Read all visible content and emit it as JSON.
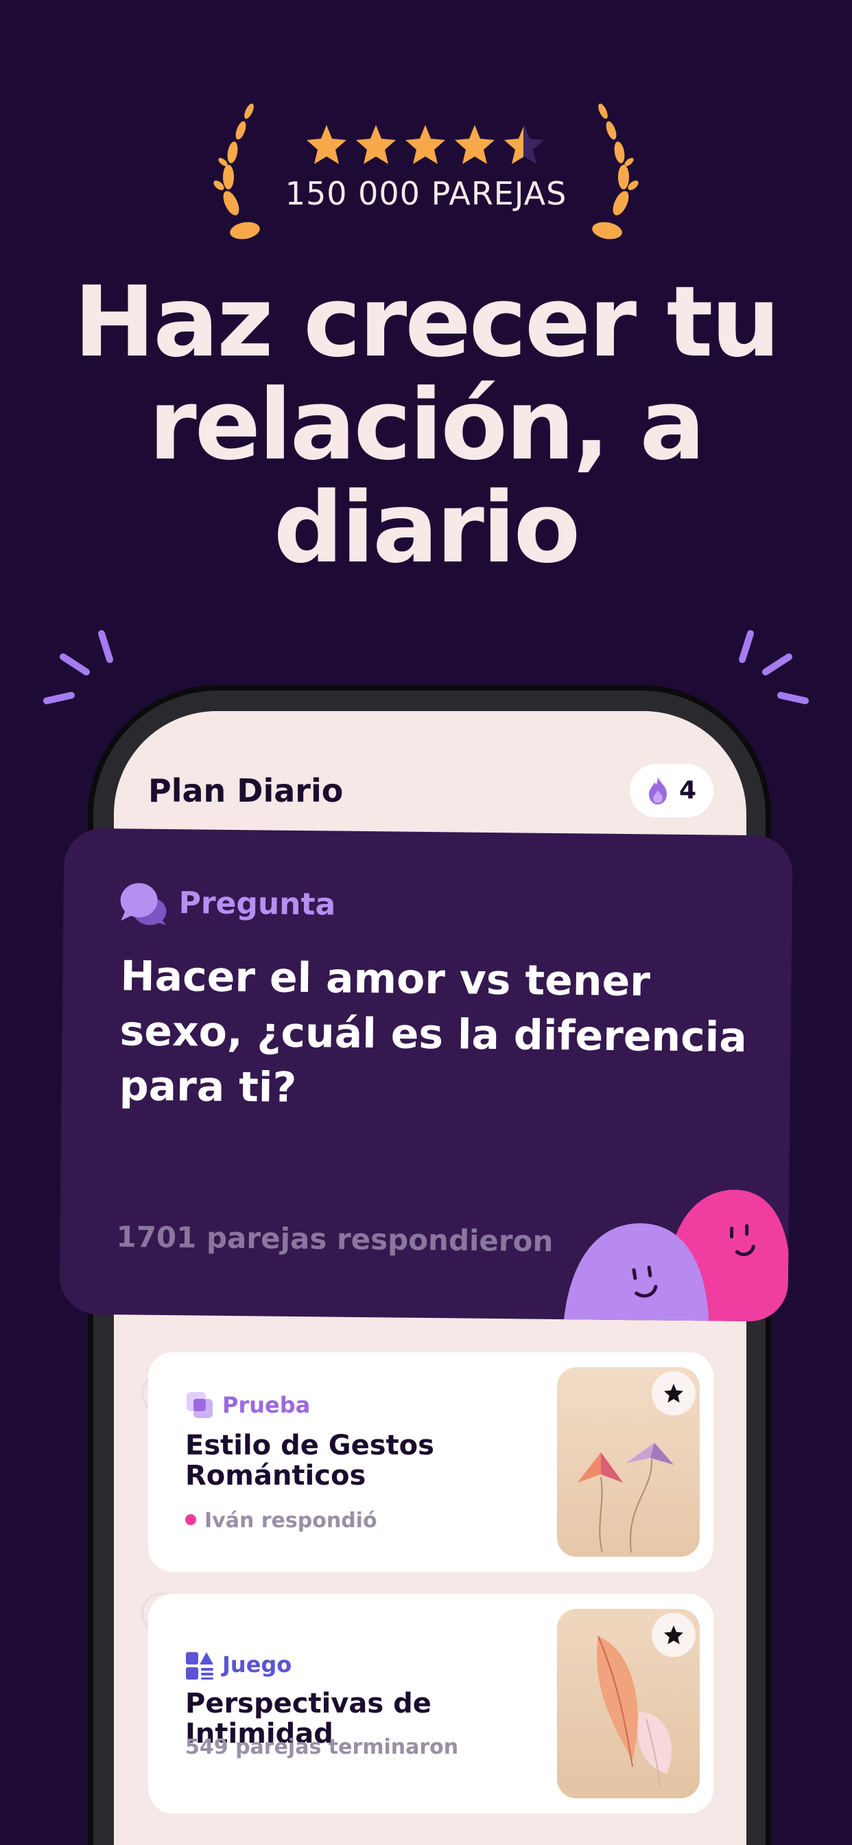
{
  "rating": {
    "stars": 4.5,
    "label": "150 000 PAREJAS",
    "star_color": "#f7a94a"
  },
  "headline": {
    "line1": "Haz crecer tu",
    "line2": "relación, a",
    "line3": "diario"
  },
  "phone": {
    "title": "Plan Diario",
    "streak": {
      "icon": "flame-icon",
      "count": "4"
    },
    "question": {
      "tag": "Pregunta",
      "icon": "chat-bubbles-icon",
      "text": "Hacer el amor vs tener sexo, ¿cuál es la diferencia para ti?",
      "count_text": "1701 parejas respondieron"
    },
    "cards": [
      {
        "type": "Prueba",
        "type_color": "#9b6ae0",
        "icon": "quiz-squares-icon",
        "title": "Estilo de Gestos Románticos",
        "subtitle": "Iván respondió",
        "status_dot_color": "#ee3d8f",
        "image": "kites-illustration",
        "favorite_icon": "star-icon"
      },
      {
        "type": "Juego",
        "type_color": "#5b55d6",
        "icon": "game-shapes-icon",
        "title": "Perspectivas de Intimidad",
        "subtitle": "549 parejas terminaron",
        "image": "feathers-illustration",
        "favorite_icon": "star-icon"
      }
    ]
  },
  "colors": {
    "background": "#1e0b35",
    "card_purple": "#35184f",
    "accent_lilac": "#b68ff0",
    "accent_pink": "#f0399f",
    "screen_bg": "#f5e8e7"
  }
}
